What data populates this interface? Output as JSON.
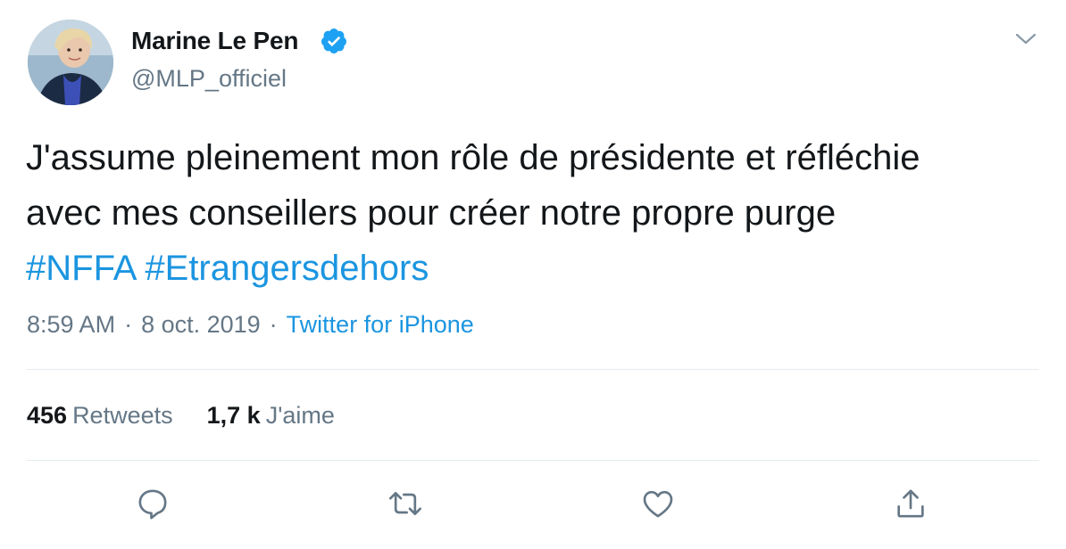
{
  "author": {
    "name": "Marine Le Pen",
    "handle": "@MLP_officiel",
    "verified": true,
    "avatar": "profile-photo"
  },
  "tweet": {
    "line1": "J'assume pleinement mon rôle de présidente et réfléchie",
    "line2": "avec mes conseillers pour créer notre propre purge",
    "hashtag1": "#NFFA",
    "hashtag2": "#Etrangersdehors"
  },
  "meta": {
    "time": "8:59 AM",
    "separator": "·",
    "date": "8 oct. 2019",
    "source": "Twitter for iPhone"
  },
  "stats": {
    "retweets_count": "456",
    "retweets_label": "Retweets",
    "likes_count": "1,7 k",
    "likes_label": "J'aime"
  },
  "actions": [
    "reply-icon",
    "retweet-icon",
    "like-icon",
    "share-icon"
  ],
  "colors": {
    "text": "#14171a",
    "secondary": "#657786",
    "link": "#1b95e0",
    "divider": "#e6ecf0",
    "verified": "#1da1f2"
  }
}
